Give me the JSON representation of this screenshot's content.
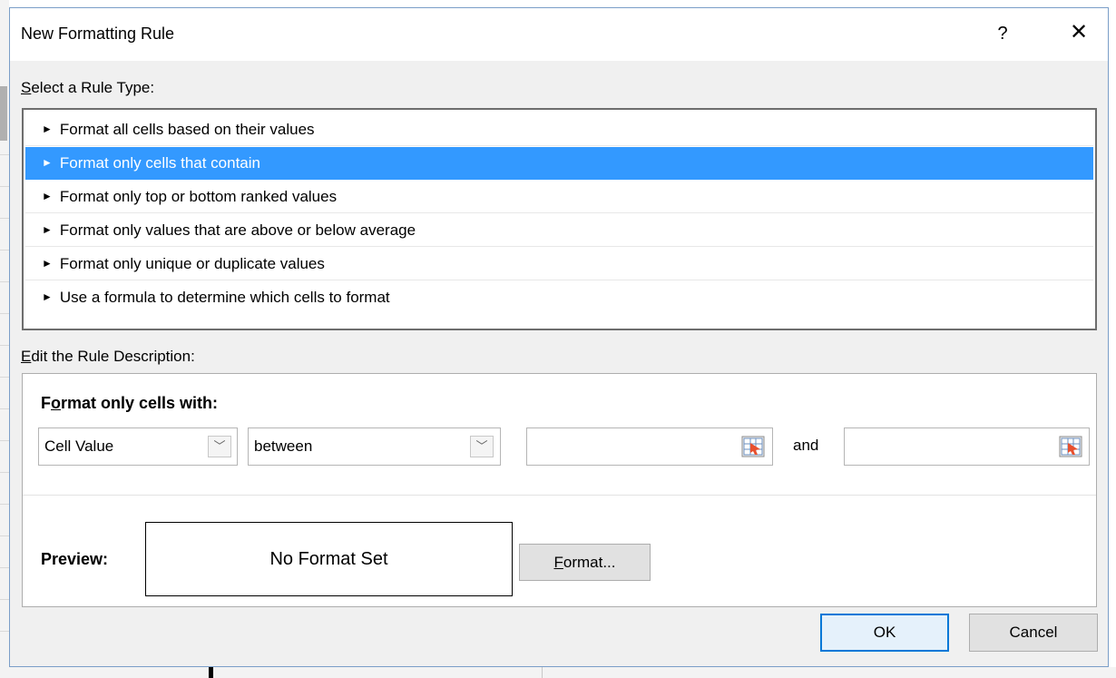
{
  "dialog": {
    "title": "New Formatting Rule",
    "help_label": "?",
    "close_label": "✕"
  },
  "rule_type": {
    "label_accel": "S",
    "label_rest": "elect a Rule Type:",
    "items": [
      {
        "label": "Format all cells based on their values",
        "selected": false
      },
      {
        "label": "Format only cells that contain",
        "selected": true
      },
      {
        "label": "Format only top or bottom ranked values",
        "selected": false
      },
      {
        "label": "Format only values that are above or below average",
        "selected": false
      },
      {
        "label": "Format only unique or duplicate values",
        "selected": false
      },
      {
        "label": "Use a formula to determine which cells to format",
        "selected": false
      }
    ],
    "arrow_glyph": "►",
    "selected_color": "#3399ff"
  },
  "description": {
    "label_accel": "E",
    "label_rest": "dit the Rule Description:",
    "heading_pre": "F",
    "heading_accel": "o",
    "heading_rest": "rmat only cells with:",
    "field_type": "Cell Value",
    "operator": "between",
    "value1": "",
    "and_label": "and",
    "value2": "",
    "dropdown_glyph": "﹀",
    "ref_icon": "range-selector-icon"
  },
  "preview": {
    "label": "Preview:",
    "text": "No Format Set",
    "format_accel": "F",
    "format_rest": "ormat..."
  },
  "buttons": {
    "ok": "OK",
    "cancel": "Cancel",
    "ok_border_color": "#0078d7"
  }
}
